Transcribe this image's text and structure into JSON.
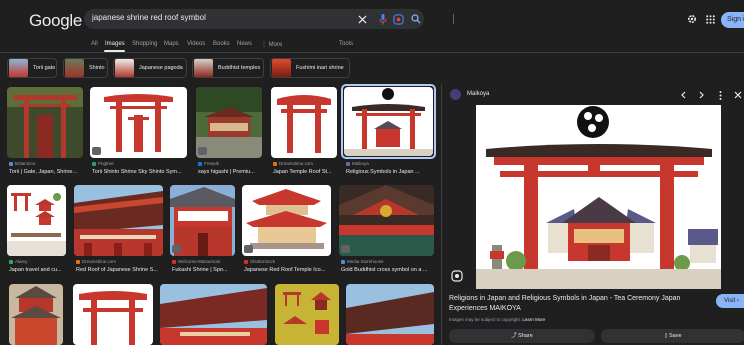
{
  "header": {
    "logo": "Google",
    "search_query": "japanese shrine red roof symbol",
    "signin_label": "Sign in"
  },
  "tabs": [
    {
      "label": "All"
    },
    {
      "label": "Images"
    },
    {
      "label": "Shopping"
    },
    {
      "label": "Maps"
    },
    {
      "label": "Videos"
    },
    {
      "label": "Books"
    },
    {
      "label": "News"
    },
    {
      "label": "⋮ More"
    },
    {
      "label": "Tools"
    }
  ],
  "chips": [
    {
      "label": "Torii gate"
    },
    {
      "label": "Shinto"
    },
    {
      "label": "Japanese pagoda"
    },
    {
      "label": "Buddhist temples"
    },
    {
      "label": "Fushimi inari shrine"
    }
  ],
  "results": [
    {
      "source": "Britannica",
      "title": "Torii | Gate, Japan, Shrine..."
    },
    {
      "source": "Pngtree",
      "title": "Torii Shinto Shrine Sky Shinto Sym..."
    },
    {
      "source": "Freepik",
      "title": "says higashi | Premiu..."
    },
    {
      "source": "Dreamstime.com",
      "title": "Japan Temple Roof St..."
    },
    {
      "source": "Maikoya",
      "title": "Religious Symbols in Japan ..."
    },
    {
      "source": "Alamy",
      "title": "Japan travel and cu..."
    },
    {
      "source": "Dreamstime.com",
      "title": "Red Roof of Japanese Shrine S..."
    },
    {
      "source": "Welcome-Matsumoto",
      "title": "Fukashi Shrine | Spo..."
    },
    {
      "source": "Shutterstock",
      "title": "Japanese Red Roof Temple Ico..."
    },
    {
      "source": "Media Storehouse",
      "title": "Gold Buddhist cross symbol on a ..."
    }
  ],
  "panel": {
    "site_name": "Maikoya",
    "title": "Religions in Japan and Religious Symbols in Japan - Tea Ceremony Japan Experiences MAIKOYA",
    "visit_label": "Visit",
    "copyright_text": "Images may be subject to copyright.",
    "learn_more": "Learn More",
    "share_label": "Share",
    "save_label": "Save"
  },
  "colors": {
    "background": "#1f1f1f",
    "accent": "#8ab4f8",
    "torii_red": "#c8372d"
  }
}
